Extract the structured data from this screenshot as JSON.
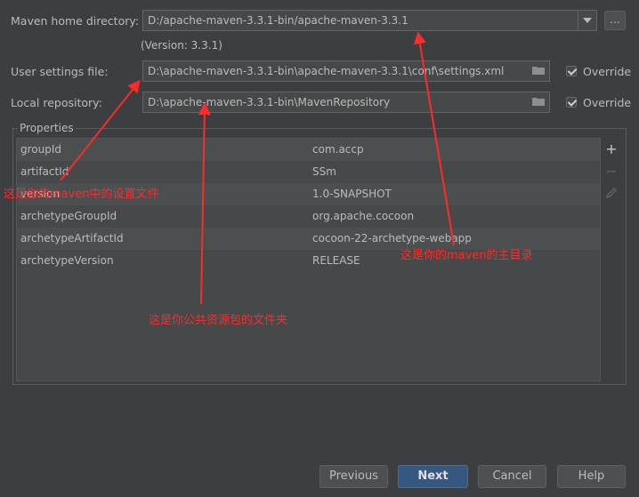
{
  "form": {
    "maven_home_label": "Maven home directory:",
    "maven_home_value": "D:/apache-maven-3.3.1-bin/apache-maven-3.3.1",
    "browse_label": "...",
    "version_text": "(Version: 3.3.1)",
    "user_settings_label": "User settings file:",
    "user_settings_value": "D:\\apache-maven-3.3.1-bin\\apache-maven-3.3.1\\conf\\settings.xml",
    "local_repo_label": "Local repository:",
    "local_repo_value": "D:\\apache-maven-3.3.1-bin\\MavenRepository",
    "override_label": "Override"
  },
  "properties": {
    "title": "Properties",
    "rows": [
      {
        "key": "groupId",
        "value": "com.accp"
      },
      {
        "key": "artifactId",
        "value": "SSm"
      },
      {
        "key": "version",
        "value": "1.0-SNAPSHOT"
      },
      {
        "key": "archetypeGroupId",
        "value": "org.apache.cocoon"
      },
      {
        "key": "archetypeArtifactId",
        "value": "cocoon-22-archetype-webapp"
      },
      {
        "key": "archetypeVersion",
        "value": "RELEASE"
      }
    ],
    "add_glyph": "+",
    "remove_glyph": "−",
    "edit_icon": "pencil-icon"
  },
  "annotations": {
    "settings_note": "这是你的maven中的设置文件",
    "home_note": "这是你的maven的主目录",
    "repo_note": "这是你公共资源包的文件夹"
  },
  "buttons": {
    "previous": "Previous",
    "next": "Next",
    "cancel": "Cancel",
    "help": "Help"
  },
  "colors": {
    "background": "#3c3f41",
    "annotation": "#ff2a2a",
    "primary_button": "#365880"
  }
}
